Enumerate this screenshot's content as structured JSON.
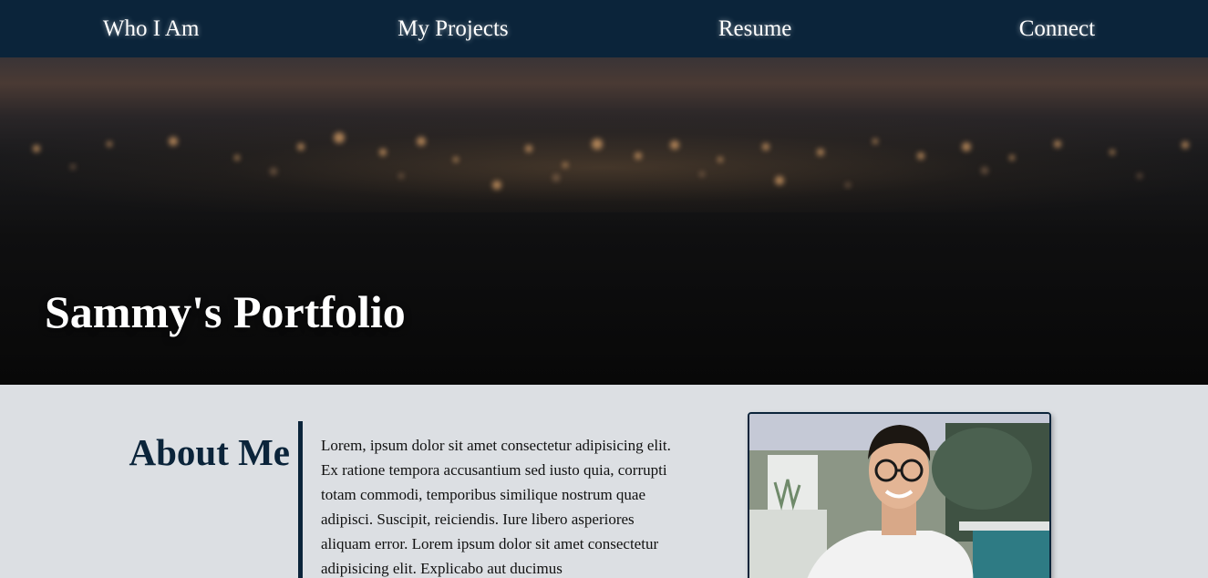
{
  "nav": {
    "items": [
      {
        "label": "Who I Am"
      },
      {
        "label": "My Projects"
      },
      {
        "label": "Resume"
      },
      {
        "label": "Connect"
      }
    ]
  },
  "hero": {
    "title": "Sammy's Portfolio"
  },
  "about": {
    "heading": "About Me",
    "body": "Lorem, ipsum dolor sit amet consectetur adipisicing elit. Ex ratione tempora accusantium sed iusto quia, corrupti totam commodi, temporibus similique nostrum quae adipisci. Suscipit, reiciendis. Iure libero asperiores aliquam error. Lorem ipsum dolor sit amet consectetur adipisicing elit. Explicabo aut ducimus"
  },
  "colors": {
    "nav_bg": "#0b243a",
    "accent": "#0b243a",
    "section_bg": "#dcdfe3"
  }
}
